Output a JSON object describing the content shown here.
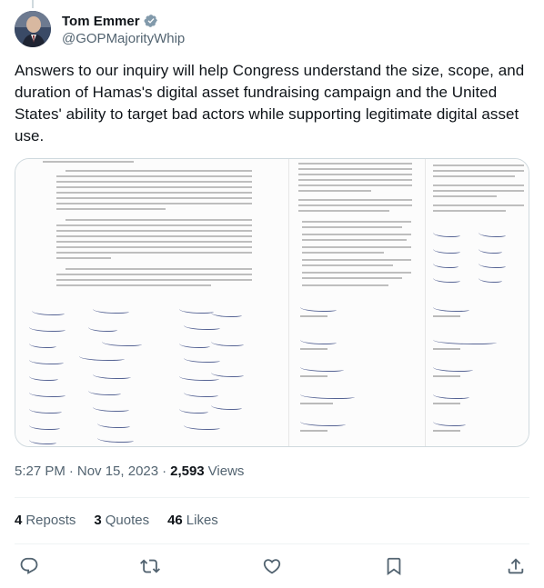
{
  "author": {
    "display_name": "Tom Emmer",
    "handle": "@GOPMajorityWhip",
    "verified": true,
    "verified_icon": "verified-badge-icon"
  },
  "tweet": {
    "text": "Answers to our inquiry will help Congress understand the size, scope, and duration of Hamas's digital asset fundraising campaign and the United States' ability to target bad actors while supporting legitimate digital asset use."
  },
  "media": {
    "type": "image",
    "description_icon": "letter-image"
  },
  "meta": {
    "time": "5:27 PM",
    "date": "Nov 15, 2023",
    "views_count": "2,593",
    "views_label": "Views"
  },
  "stats": {
    "reposts_count": "4",
    "reposts_label": "Reposts",
    "quotes_count": "3",
    "quotes_label": "Quotes",
    "likes_count": "46",
    "likes_label": "Likes"
  },
  "actions": {
    "reply_icon": "reply-icon",
    "repost_icon": "repost-icon",
    "like_icon": "heart-icon",
    "bookmark_icon": "bookmark-icon",
    "share_icon": "share-icon"
  },
  "colors": {
    "verified": "#1d9bf0",
    "secondary_text": "#536471",
    "primary_text": "#0f1419",
    "border": "#cfd9de"
  }
}
